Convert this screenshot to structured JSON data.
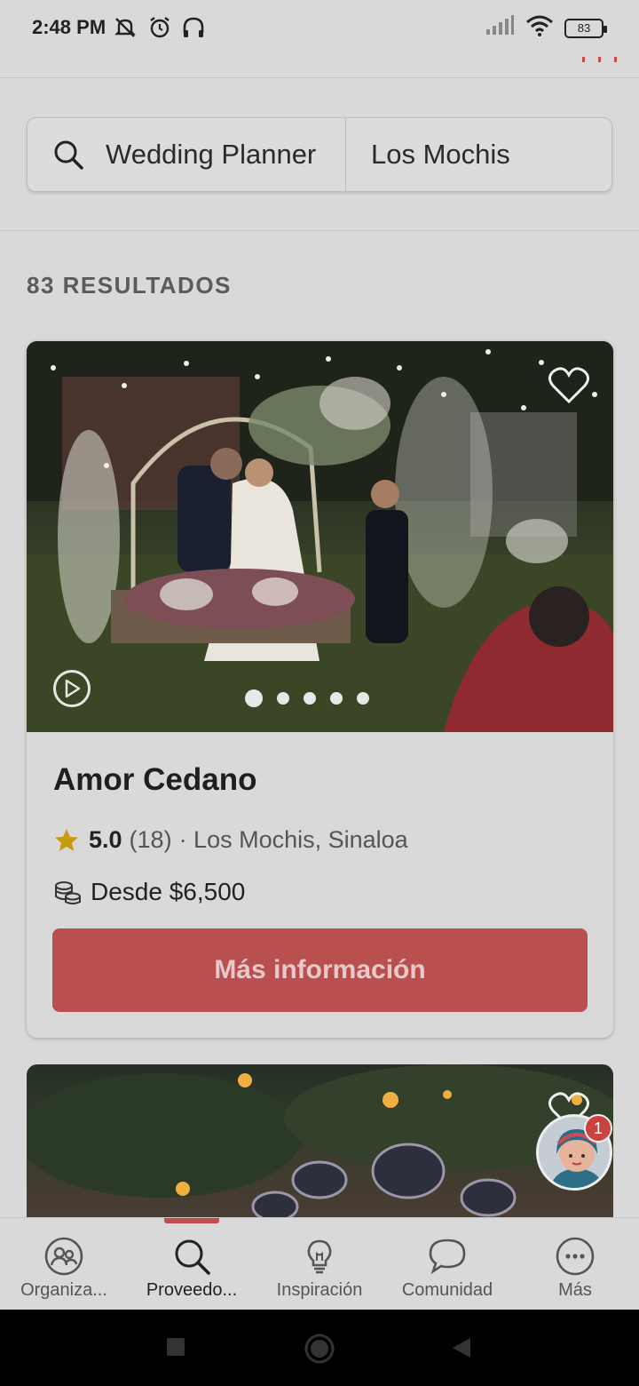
{
  "status_bar": {
    "time": "2:48 PM",
    "battery": "83",
    "icons": [
      "mute-icon",
      "alarm-icon",
      "headphones-icon",
      "signal-icon",
      "wifi-icon",
      "battery-icon"
    ]
  },
  "search": {
    "query": "Wedding Planner",
    "location": "Los Mochis"
  },
  "results": {
    "count_label": "83 RESULTADOS"
  },
  "vendor_card": {
    "name": "Amor Cedano",
    "rating": "5.0",
    "reviews": "(18)",
    "location": "· Los Mochis, Sinaloa",
    "price": "Desde $6,500",
    "cta": "Más información",
    "carousel_total": 5,
    "carousel_active": 1
  },
  "assistant": {
    "badge": "1"
  },
  "bottom_nav": {
    "items": [
      {
        "label": "Organiza...",
        "icon": "people-icon"
      },
      {
        "label": "Proveedo...",
        "icon": "search-icon"
      },
      {
        "label": "Inspiración",
        "icon": "lightbulb-icon"
      },
      {
        "label": "Comunidad",
        "icon": "chat-bubble-icon"
      },
      {
        "label": "Más",
        "icon": "more-icon"
      }
    ],
    "active_index": 1
  },
  "colors": {
    "accent": "#b94f4f",
    "indicator": "#c44c4c",
    "star": "#c89a10",
    "background": "#d9d9d9"
  }
}
